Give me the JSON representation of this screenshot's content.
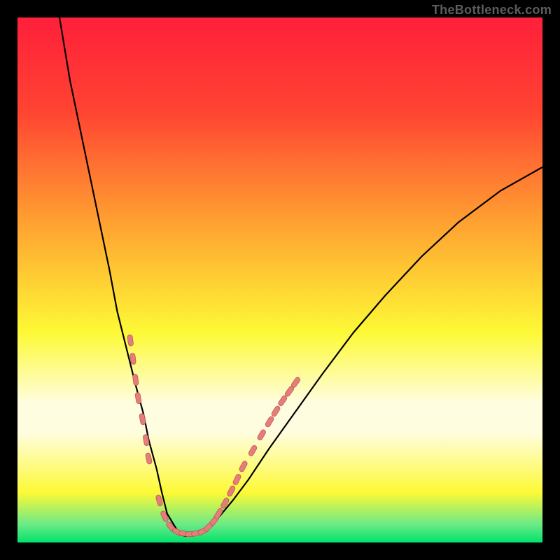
{
  "watermark": {
    "text": "TheBottleneck.com"
  },
  "colors": {
    "black": "#000000",
    "red": "#ff1f3a",
    "orange": "#ffa531",
    "yellow": "#fdf936",
    "pale": "#fffde0",
    "green_light": "#6dea86",
    "green": "#00e36b",
    "curve": "#000000",
    "marker_fill": "#e77d7a",
    "marker_stroke": "#b85a57"
  },
  "gradient_stops": [
    {
      "offset": 0.0,
      "color": "#ff1f3a"
    },
    {
      "offset": 0.18,
      "color": "#ff4432"
    },
    {
      "offset": 0.4,
      "color": "#ffa531"
    },
    {
      "offset": 0.6,
      "color": "#fdf936"
    },
    {
      "offset": 0.735,
      "color": "#fffde0"
    },
    {
      "offset": 0.79,
      "color": "#fffde0"
    },
    {
      "offset": 0.905,
      "color": "#fdf936"
    },
    {
      "offset": 0.965,
      "color": "#6dea86"
    },
    {
      "offset": 1.0,
      "color": "#00e36b"
    }
  ],
  "chart_data": {
    "type": "line",
    "title": "",
    "xlabel": "",
    "ylabel": "",
    "xlim": [
      0,
      100
    ],
    "ylim": [
      0,
      100
    ],
    "series": [
      {
        "name": "curve",
        "x": [
          8.0,
          10.0,
          12.5,
          15.0,
          17.5,
          19.0,
          21.0,
          22.5,
          24.0,
          25.0,
          26.5,
          27.5,
          28.5,
          30.0,
          31.0,
          32.0,
          33.5,
          35.0,
          36.5,
          38.5,
          41.0,
          44.0,
          48.0,
          53.0,
          58.0,
          64.0,
          70.0,
          77.0,
          84.0,
          92.0,
          100.0
        ],
        "y": [
          100.0,
          88.0,
          76.0,
          64.0,
          52.0,
          44.0,
          36.0,
          30.0,
          24.5,
          19.5,
          14.0,
          9.5,
          5.5,
          3.0,
          1.5,
          1.2,
          1.3,
          1.8,
          3.0,
          5.0,
          8.0,
          12.0,
          18.0,
          25.0,
          32.0,
          40.0,
          47.0,
          54.5,
          61.0,
          67.0,
          71.5
        ]
      }
    ],
    "markers": {
      "name": "gpu-points",
      "shape": "capsule",
      "points": [
        {
          "x": 21.5,
          "y": 38.5
        },
        {
          "x": 22.0,
          "y": 35.0
        },
        {
          "x": 22.5,
          "y": 31.0
        },
        {
          "x": 23.0,
          "y": 27.5
        },
        {
          "x": 23.8,
          "y": 23.5
        },
        {
          "x": 24.5,
          "y": 19.5
        },
        {
          "x": 25.0,
          "y": 16.0
        },
        {
          "x": 27.0,
          "y": 8.0
        },
        {
          "x": 28.0,
          "y": 5.0
        },
        {
          "x": 29.2,
          "y": 3.0
        },
        {
          "x": 30.5,
          "y": 2.0
        },
        {
          "x": 31.8,
          "y": 1.7
        },
        {
          "x": 33.0,
          "y": 1.6
        },
        {
          "x": 34.2,
          "y": 1.8
        },
        {
          "x": 35.4,
          "y": 2.2
        },
        {
          "x": 36.4,
          "y": 3.0
        },
        {
          "x": 37.5,
          "y": 4.2
        },
        {
          "x": 38.3,
          "y": 5.5
        },
        {
          "x": 39.5,
          "y": 7.5
        },
        {
          "x": 40.7,
          "y": 9.8
        },
        {
          "x": 41.8,
          "y": 12.0
        },
        {
          "x": 43.0,
          "y": 14.5
        },
        {
          "x": 44.8,
          "y": 17.5
        },
        {
          "x": 46.5,
          "y": 20.5
        },
        {
          "x": 48.0,
          "y": 23.0
        },
        {
          "x": 49.2,
          "y": 25.0
        },
        {
          "x": 50.5,
          "y": 27.0
        },
        {
          "x": 51.8,
          "y": 28.8
        },
        {
          "x": 53.0,
          "y": 30.5
        }
      ]
    }
  }
}
